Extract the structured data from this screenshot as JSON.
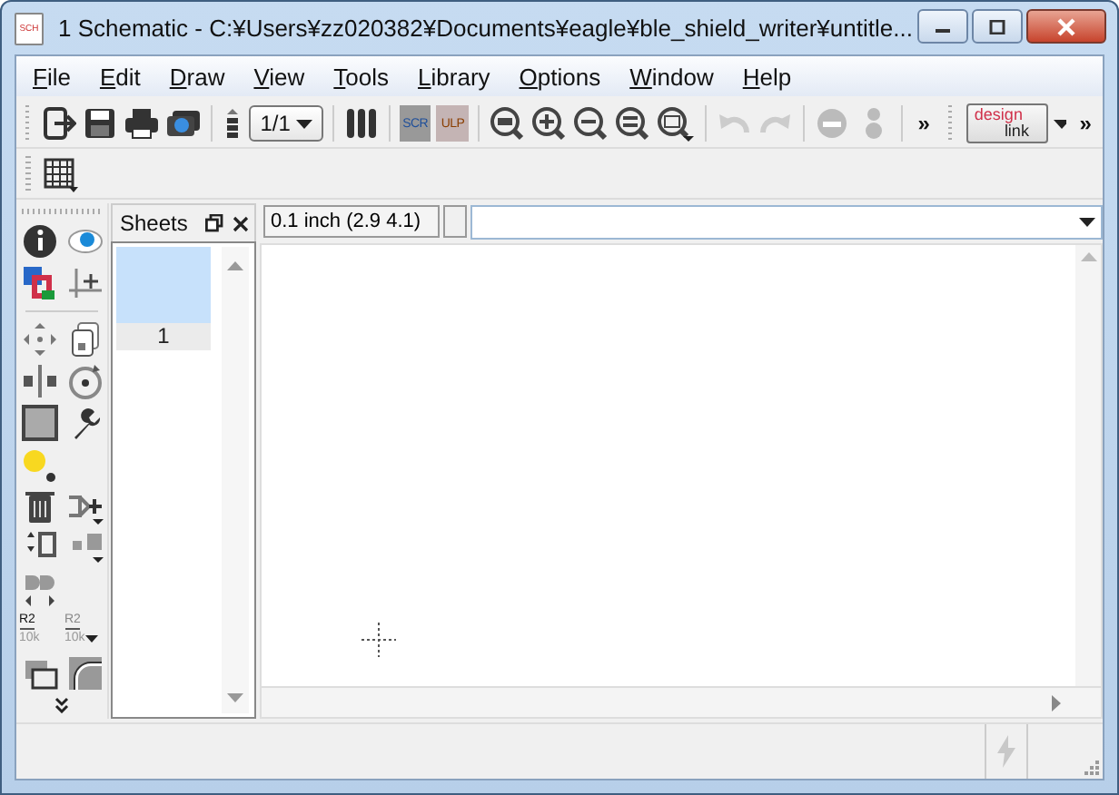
{
  "window": {
    "title": "1 Schematic - C:¥Users¥zz020382¥Documents¥eagle¥ble_shield_writer¥untitle...",
    "app_icon_label": "SCH"
  },
  "menu": [
    {
      "label": "File"
    },
    {
      "label": "Edit"
    },
    {
      "label": "Draw"
    },
    {
      "label": "View"
    },
    {
      "label": "Tools"
    },
    {
      "label": "Library"
    },
    {
      "label": "Options"
    },
    {
      "label": "Window"
    },
    {
      "label": "Help"
    }
  ],
  "toolbar": {
    "sheet_select": "1/1",
    "script_label": "SCR",
    "ulp_label": "ULP",
    "undo": {
      "disabled": true
    },
    "redo": {
      "disabled": true
    },
    "overflow": "»",
    "design_link": {
      "top": "design",
      "bottom": "link"
    },
    "overflow_2": "»"
  },
  "left_toolbar": {
    "name_tool": {
      "top": "R2",
      "bottom": "10k"
    },
    "value_tool": {
      "top": "R2",
      "bottom": "10k"
    }
  },
  "sheets_panel": {
    "title": "Sheets",
    "sheets": [
      {
        "label": "1",
        "selected": true
      }
    ]
  },
  "command_bar": {
    "grid_readout": "0.1 inch (2.9 4.1)"
  }
}
